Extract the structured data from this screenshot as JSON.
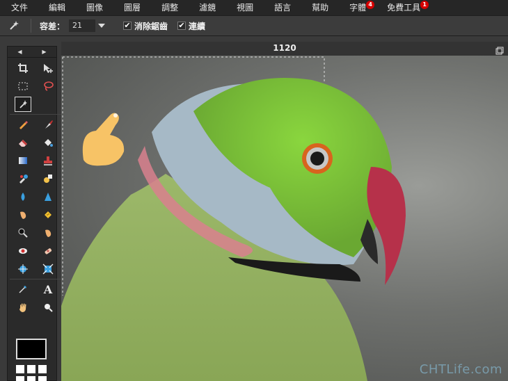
{
  "menu": [
    {
      "label": "文件"
    },
    {
      "label": "編輯"
    },
    {
      "label": "圖像"
    },
    {
      "label": "圖層"
    },
    {
      "label": "調整"
    },
    {
      "label": "濾鏡"
    },
    {
      "label": "視圖"
    },
    {
      "label": "語言"
    },
    {
      "label": "幫助"
    },
    {
      "label": "字體",
      "badge": "4"
    },
    {
      "label": "免費工具",
      "badge": "1"
    }
  ],
  "options": {
    "tool_icon": "magic-wand-icon",
    "tolerance_label": "容差：",
    "tolerance_value": "21",
    "contiguous_label": "消除鋸齒",
    "contiguous_checked": true,
    "sample_label": "連續",
    "sample_checked": true
  },
  "toolbox": {
    "prev": "◀",
    "next": "▶",
    "tools": [
      "crop-icon",
      "move-icon",
      "marquee-icon",
      "lasso-icon",
      "magic-wand-icon",
      "",
      "pencil-icon",
      "brush-icon",
      "eraser-icon",
      "bucket-icon",
      "gradient-icon",
      "stamp-icon",
      "color-replace-icon",
      "drawing-icon",
      "blur-icon",
      "sharpen-icon",
      "smudge-icon",
      "sponge-icon",
      "dodge-icon",
      "burn-icon",
      "red-eye-icon",
      "spot-heal-icon",
      "bloat-icon",
      "pinch-icon",
      "color-picker-icon",
      "text-icon",
      "hand-icon",
      "zoom-icon"
    ],
    "primary_color": "#000000",
    "secondary_color": "#ffffff"
  },
  "document": {
    "title": "1120",
    "watermark": "CHTLife.com"
  },
  "colors": {
    "parrot_body": "#8fae5d",
    "parrot_head": "#7bc33a",
    "beak": "#b6314a",
    "ring_pink": "#d9808e",
    "ring_black": "#1a1a1a"
  }
}
